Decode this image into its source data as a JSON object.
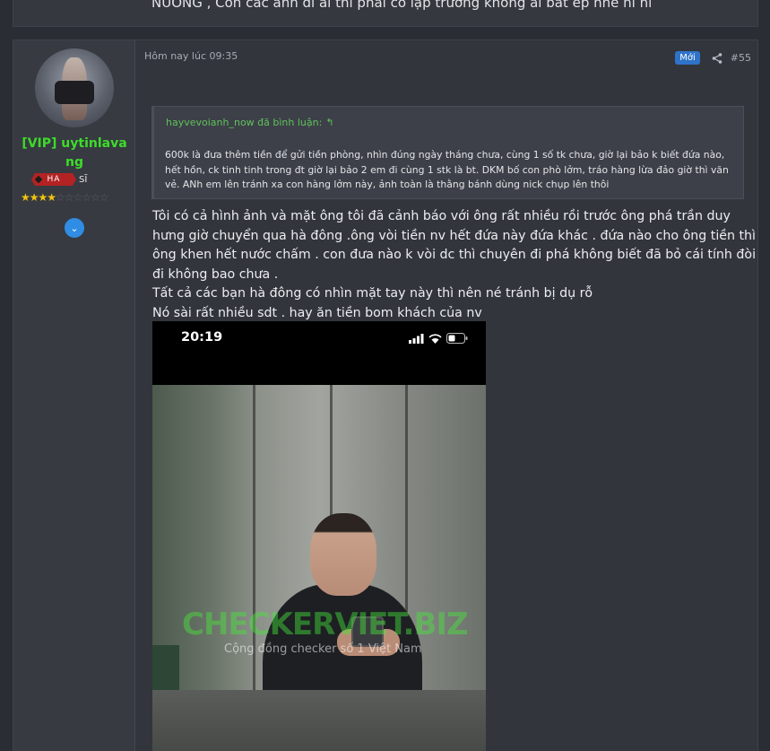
{
  "prev_post": {
    "text": "NUONG , Còn các anh đi ai thì phải có lập trường không ai bắt ép nhé hi hi"
  },
  "post": {
    "user": {
      "name": "[VIP] uytinlavang",
      "rank_badge": "HA",
      "rank_text": "SĨ",
      "stars_filled": 3.5,
      "stars_total": 10,
      "avatar_icon": "avatar"
    },
    "date": "Hôm nay lúc 09:35",
    "badge": "Mới",
    "number": "#55",
    "quote": {
      "author": "hayvevoianh_now đã bình luận:",
      "body": "600k là đưa thêm tiền để gửi tiền phòng, nhìn đúng ngày tháng chưa, cùng 1 số tk chưa, giờ lại bảo k biết đứa nào, hết hồn, ck tinh tinh trong đt giờ lại bảo 2 em đi cùng 1 stk là bt. DKM bố con phò lởm, tráo hàng lừa đảo giờ thì văn vẻ. ANh em lên tránh xa con hàng lởm này, ảnh toàn là thằng bánh dùng nick chụp lên thôi"
    },
    "body_lines": [
      "Tôi có cả hình ảnh và mặt ông tôi đã cảnh báo với ông rất nhiều rồi trước ông phá trần duy hưng giờ chuyển qua hà đông .ông vòi tiền nv hết đứa này đứa khác . đứa nào cho ông tiền thì ông khen hết nước chấm . con đưa nào k vòi dc thì chuyên đi phá không biết đã bỏ cái tính đòi đi không bao chưa .",
      "Tất cả các bạn hà đông có nhìn mặt tay này thì nên né tránh bị dụ rỗ",
      "Nó sài rất nhiều sdt . hay ăn tiền bom khách của nv"
    ],
    "image": {
      "clock": "20:19",
      "watermark": "CHECKERVIET.BIZ",
      "watermark_sub": "Cộng đồng checker số 1 Việt Nam"
    }
  },
  "colors": {
    "username": "#3ddc2a",
    "badge_new": "#2f73c9",
    "quote_author": "#5fc25a",
    "rank_badge": "#b32323"
  }
}
